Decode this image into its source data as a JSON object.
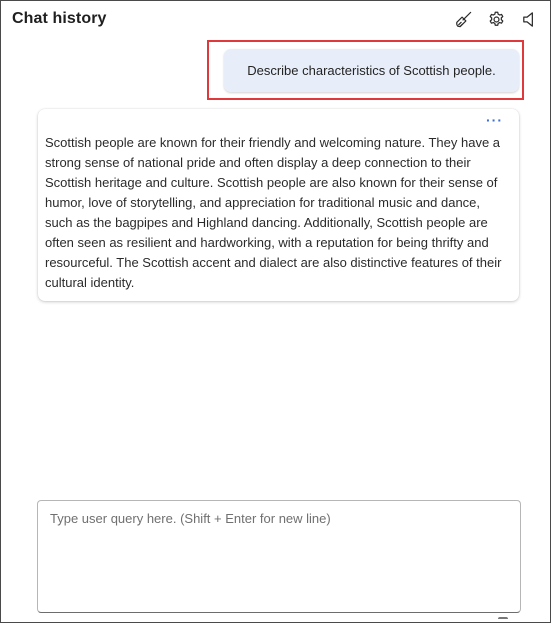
{
  "header": {
    "title": "Chat history",
    "icons": [
      "broom-icon",
      "gear-icon",
      "speaker-icon"
    ]
  },
  "messages": {
    "user": "Describe characteristics of Scottish people.",
    "bot": "Scottish people are known for their friendly and welcoming nature. They have a strong sense of national pride and often display a deep connection to their Scottish heritage and culture. Scottish people are also known for their sense of humor, love of storytelling, and appreciation for traditional music and dance, such as the bagpipes and Highland dancing. Additionally, Scottish people are often seen as resilient and hardworking, with a reputation for being thrifty and resourceful. The Scottish accent and dialect are also distinctive features of their cultural identity.",
    "more_label": "···"
  },
  "input": {
    "placeholder": "Type user query here. (Shift + Enter for new line)",
    "value": ""
  },
  "colors": {
    "highlight": "#e0393b",
    "user_bubble": "#e8eef9",
    "accent": "#3b6fd4"
  }
}
